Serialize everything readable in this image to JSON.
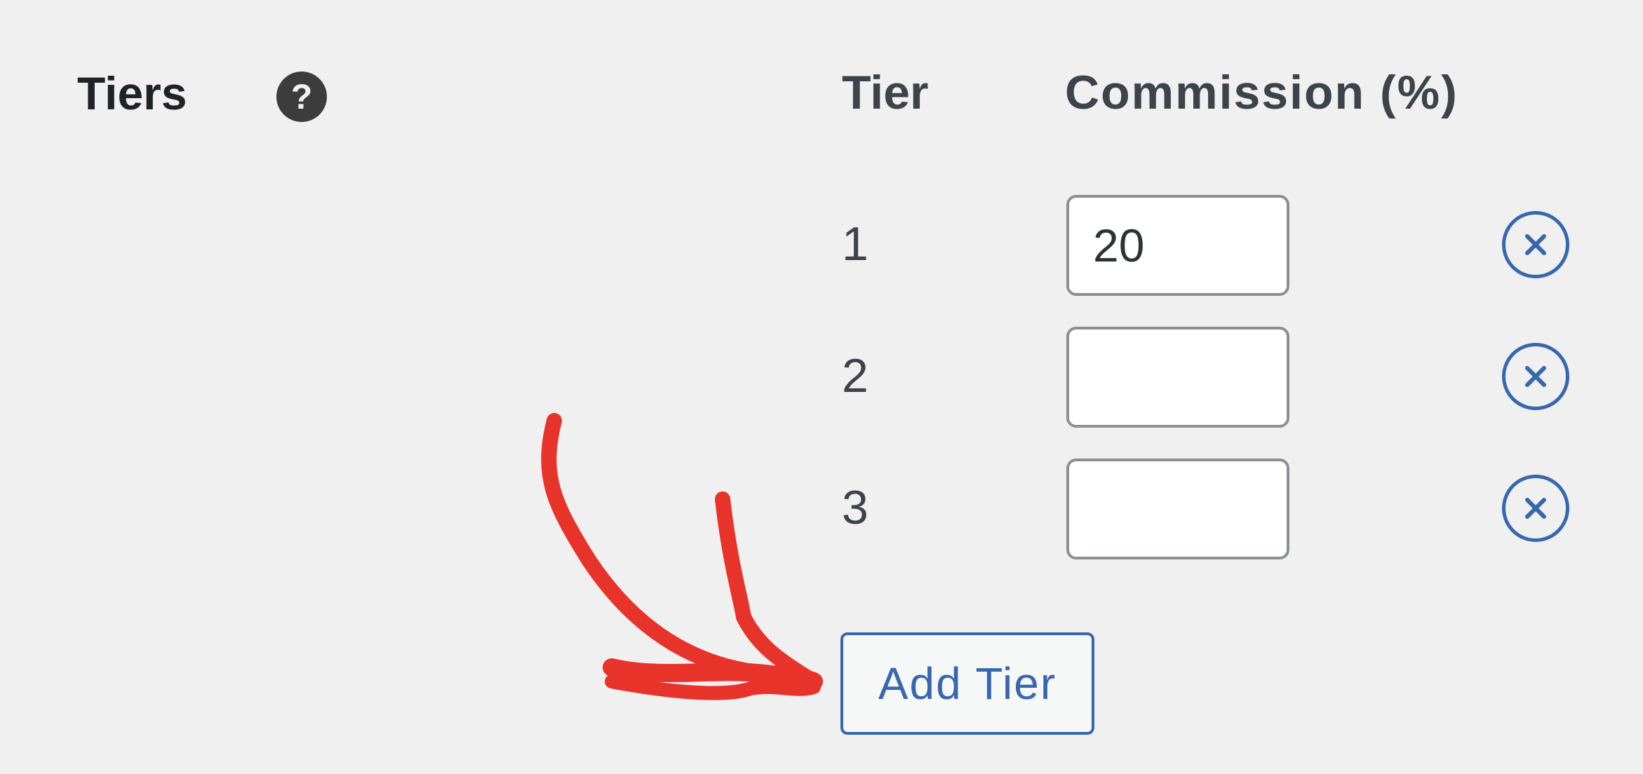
{
  "settings": {
    "tiers_label": "Tiers",
    "help_icon_glyph": "?",
    "help_icon": "question-circle-icon"
  },
  "table": {
    "headers": {
      "tier": "Tier",
      "commission": "Commission (%)"
    },
    "rows": [
      {
        "tier": "1",
        "commission": "20"
      },
      {
        "tier": "2",
        "commission": ""
      },
      {
        "tier": "3",
        "commission": ""
      }
    ],
    "remove_icon": "circle-x-icon"
  },
  "actions": {
    "add_tier_label": "Add Tier"
  },
  "annotation": {
    "icon": "hand-drawn-arrow-icon",
    "color": "#e8332a"
  },
  "colors": {
    "accent": "#3767ad",
    "background": "#f0f0f1",
    "input_border": "#8c8f94",
    "text": "#1d2327"
  }
}
